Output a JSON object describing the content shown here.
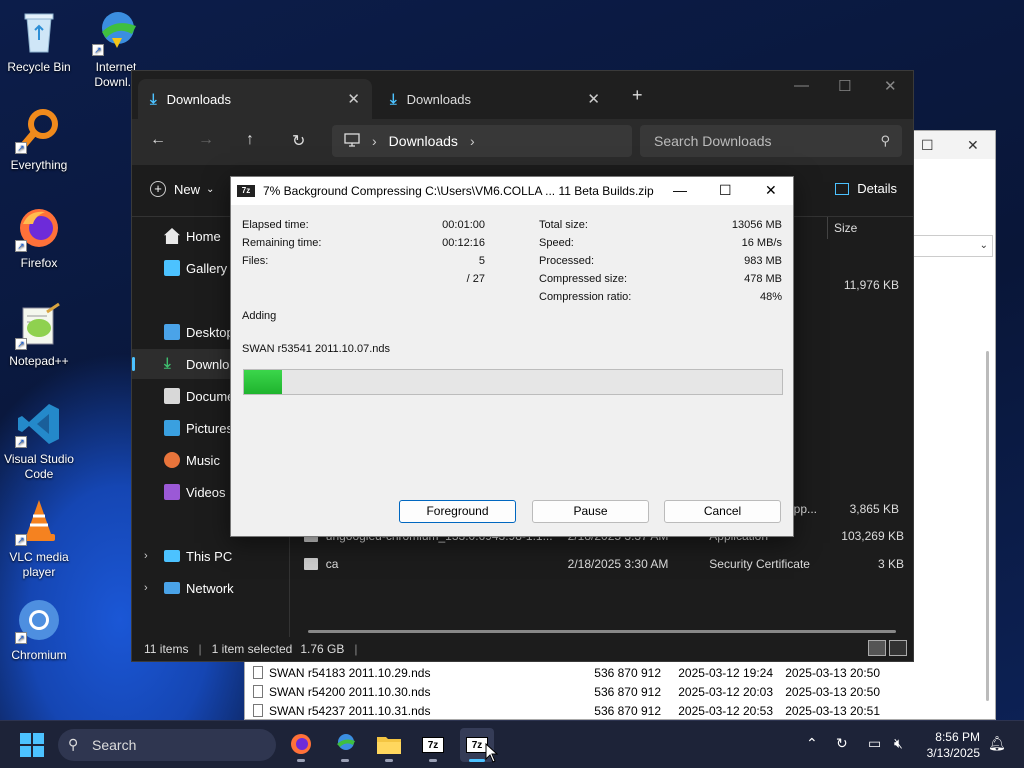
{
  "desktop": {
    "icons": [
      {
        "label": "Recycle Bin"
      },
      {
        "label": "Internet Downl..."
      },
      {
        "label": "Everything"
      },
      {
        "label": "Firefox"
      },
      {
        "label": "Notepad++"
      },
      {
        "label": "Visual Studio Code"
      },
      {
        "label": "VLC media player"
      },
      {
        "label": "Chromium"
      }
    ]
  },
  "background_window": {
    "rows": [
      {
        "name": "SWAN r54183 2011.10.29.nds",
        "size": "536 870 912",
        "modified": "2025-03-12 19:24",
        "created": "2025-03-13 20:50"
      },
      {
        "name": "SWAN r54200 2011.10.30.nds",
        "size": "536 870 912",
        "modified": "2025-03-12 20:03",
        "created": "2025-03-13 20:50"
      },
      {
        "name": "SWAN r54237 2011.10.31.nds",
        "size": "536 870 912",
        "modified": "2025-03-12 20:53",
        "created": "2025-03-13 20:51"
      }
    ]
  },
  "explorer": {
    "tabs": [
      {
        "label": "Downloads",
        "close": "✕"
      },
      {
        "label": "Downloads",
        "close": "✕"
      }
    ],
    "new_tab": "+",
    "address": {
      "root_icon": "monitor-icon",
      "segment": "Downloads",
      "sep": "›"
    },
    "search_placeholder": "Search Downloads",
    "command_bar": {
      "new_label": "New",
      "details_label": "Details"
    },
    "sidebar": [
      {
        "label": "Home"
      },
      {
        "label": "Gallery"
      },
      {
        "label": "Desktop"
      },
      {
        "label": "Downloads"
      },
      {
        "label": "Documents"
      },
      {
        "label": "Pictures"
      },
      {
        "label": "Music"
      },
      {
        "label": "Videos"
      },
      {
        "label": "This PC"
      },
      {
        "label": "Network"
      }
    ],
    "column_size": "Size",
    "sizes": {
      "first": "11,976 KB",
      "app_partial": "3,865 KB"
    },
    "partial_type": "App...",
    "files": [
      {
        "name": "ungoogled-chromium_133.0.6943.98-1.1...",
        "date": "2/18/2025 3:37 AM",
        "type": "Application",
        "size": "103,269 KB"
      },
      {
        "name": "ca",
        "date": "2/18/2025 3:30 AM",
        "type": "Security Certificate",
        "size": "3 KB"
      }
    ],
    "status": {
      "count": "11 items",
      "selected": "1 item selected",
      "size": "1.76 GB"
    }
  },
  "zip_dialog": {
    "title": "7% Background Compressing C:\\Users\\VM6.COLLA ... 11 Beta Builds.zip",
    "logo": "7z",
    "left_stats": [
      {
        "label": "Elapsed time:",
        "value": "00:01:00"
      },
      {
        "label": "Remaining time:",
        "value": "00:12:16"
      },
      {
        "label": "Files:",
        "value": "5"
      },
      {
        "label": "",
        "value": "/ 27"
      }
    ],
    "right_stats": [
      {
        "label": "Total size:",
        "value": "13056 MB"
      },
      {
        "label": "Speed:",
        "value": "16 MB/s"
      },
      {
        "label": "Processed:",
        "value": "983 MB"
      },
      {
        "label": "Compressed size:",
        "value": "478 MB"
      },
      {
        "label": "Compression ratio:",
        "value": "48%"
      }
    ],
    "operation": "Adding",
    "current_file": "SWAN r53541 2011.10.07.nds",
    "progress_fraction": 0.07,
    "buttons": {
      "foreground": "Foreground",
      "pause": "Pause",
      "cancel": "Cancel"
    }
  },
  "taskbar": {
    "search_label": "Search",
    "apps": [
      "firefox-icon",
      "internet-download-manager-icon",
      "file-explorer-icon",
      "7zip-icon",
      "7zip-active-icon"
    ],
    "sevenzip_label": "7z",
    "clock": {
      "time": "8:56 PM",
      "date": "3/13/2025"
    }
  },
  "colors": {
    "accent": "#4cc2ff",
    "progress": "#1fb42e"
  }
}
